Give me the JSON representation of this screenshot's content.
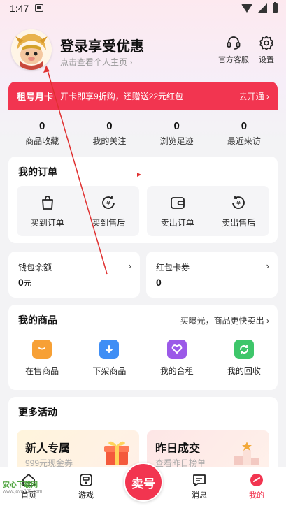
{
  "status_bar": {
    "time": "1:47"
  },
  "header": {
    "title": "登录享受优惠",
    "subtitle": "点击查看个人主页",
    "service_label": "官方客服",
    "settings_label": "设置"
  },
  "banner": {
    "title": "租号月卡",
    "description": "开卡即享9折购，还赠送22元红包",
    "action": "去开通"
  },
  "stats": [
    {
      "value": "0",
      "label": "商品收藏"
    },
    {
      "value": "0",
      "label": "我的关注"
    },
    {
      "value": "0",
      "label": "浏览足迹"
    },
    {
      "value": "0",
      "label": "最近来访"
    }
  ],
  "orders": {
    "title": "我的订单",
    "items": [
      {
        "label": "买到订单"
      },
      {
        "label": "买到售后"
      },
      {
        "label": "卖出订单"
      },
      {
        "label": "卖出售后"
      }
    ]
  },
  "wallet": {
    "label": "钱包余额",
    "value": "0",
    "unit": "元"
  },
  "coupon": {
    "label": "红包卡券",
    "value": "0"
  },
  "goods": {
    "title": "我的商品",
    "hint": "买曝光，商品更快卖出",
    "items": [
      {
        "label": "在售商品",
        "color": "#f7a035"
      },
      {
        "label": "下架商品",
        "color": "#3f8ef5"
      },
      {
        "label": "我的合租",
        "color": "#9b59e8"
      },
      {
        "label": "我的回收",
        "color": "#3ec66a"
      }
    ]
  },
  "activities": {
    "title": "更多活动",
    "promos": [
      {
        "title": "新人专属",
        "subtitle": "999元现金券"
      },
      {
        "title": "昨日成交",
        "subtitle": "查看昨日榜单"
      }
    ]
  },
  "bottom_nav": {
    "home": "首页",
    "game": "游戏",
    "center": "卖号",
    "message": "消息",
    "mine": "我的"
  },
  "watermark": {
    "name": "安心下载网",
    "url": "www.java800.com"
  },
  "colors": {
    "accent": "#f23550"
  }
}
